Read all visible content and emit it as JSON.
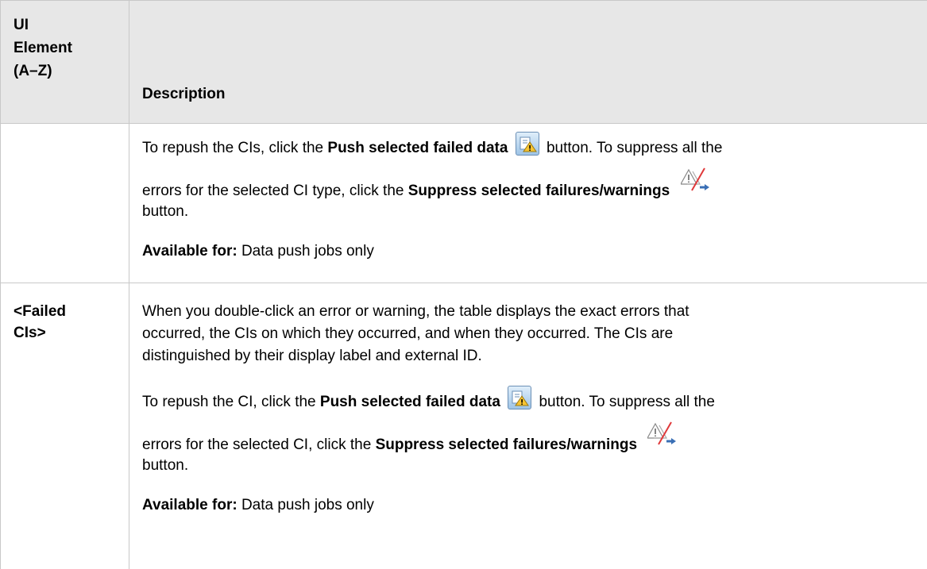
{
  "header": {
    "col1_line1": "UI",
    "col1_line2": "Element",
    "col1_line3": "(A–Z)",
    "col2": "Description"
  },
  "row1": {
    "line1_pre": "To repush the CIs, click the ",
    "line1_bold": "Push selected failed data",
    "line1_post": " button. To suppress all the",
    "line2_pre": "errors for the selected CI type, click the ",
    "line2_bold": "Suppress selected failures/warnings",
    "line3": "button.",
    "avail_label": "Available for:",
    "avail_value": " Data push jobs only"
  },
  "row2": {
    "name_line1": "<Failed",
    "name_line2": "CIs>",
    "desc_line1": "When you double-click an error or warning, the table displays the exact errors that",
    "desc_line2": "occurred, the CIs on which they occurred, and when they occurred. The CIs are",
    "desc_line3": "distinguished by their display label and external ID.",
    "line4_pre": "To repush the CI, click the ",
    "line4_bold": "Push selected failed data",
    "line4_post": " button. To suppress all the",
    "line5_pre": "errors for the selected CI, click the ",
    "line5_bold": "Suppress selected failures/warnings",
    "line6": "button.",
    "avail_label": "Available for:",
    "avail_value": " Data push jobs only"
  },
  "icons": {
    "push": "push-selected-failed-data-icon",
    "suppress": "suppress-selected-failures-icon"
  }
}
